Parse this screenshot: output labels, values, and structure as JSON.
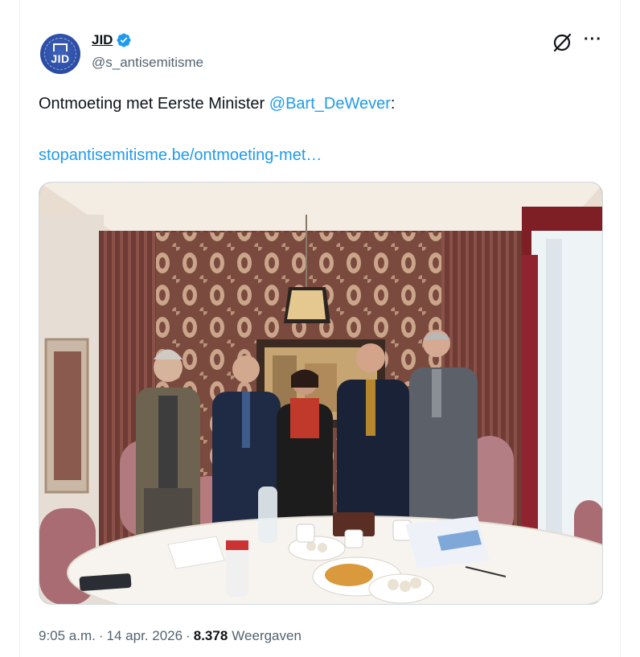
{
  "author": {
    "display_name": "JID",
    "handle": "@s_antisemitisme",
    "avatar_monogram": "JID",
    "verified_color": "#1d9bf0"
  },
  "tweet": {
    "text_prefix": "Ontmoeting met Eerste Minister ",
    "mention": "@Bart_DeWever",
    "text_suffix": ":",
    "link": "stopantisemitisme.be/ontmoeting-met…"
  },
  "meta": {
    "time": "9:05 a.m.",
    "date": "14 apr. 2026",
    "views_count": "8.378",
    "views_label": "Weergaven",
    "separator": "·"
  },
  "icons": {
    "grok": "grok-icon",
    "more": "more-icon",
    "verified": "verified-badge-icon"
  },
  "colors": {
    "accent": "#1d9bf0",
    "text": "#0f1419",
    "secondary": "#536471"
  }
}
